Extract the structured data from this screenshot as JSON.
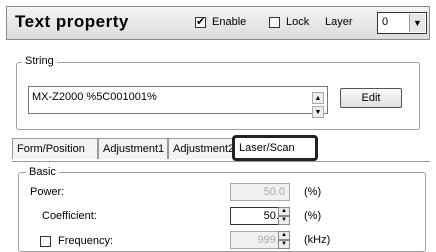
{
  "header": {
    "title": "Text property",
    "enable": {
      "label": "Enable",
      "checked": true
    },
    "lock": {
      "label": "Lock",
      "checked": false
    },
    "layer": {
      "label": "Layer",
      "value": "0"
    }
  },
  "string_group": {
    "label": "String",
    "value": "MX-Z2000 %5C001001%",
    "edit_label": "Edit"
  },
  "tabs": [
    {
      "label": "Form/Position",
      "active": false
    },
    {
      "label": "Adjustment1",
      "active": false
    },
    {
      "label": "Adjustment2",
      "active": false
    },
    {
      "label": "Laser/Scan",
      "active": true
    }
  ],
  "basic": {
    "label": "Basic",
    "power": {
      "label": "Power:",
      "value": "50.0",
      "unit": "(%)",
      "enabled": false
    },
    "coefficient": {
      "label": "Coefficient:",
      "value": "50.0",
      "unit": "(%)",
      "enabled": true
    },
    "frequency": {
      "label": "Frequency:",
      "value": "999.9",
      "unit": "(kHz)",
      "enabled": false,
      "checked": false
    }
  }
}
